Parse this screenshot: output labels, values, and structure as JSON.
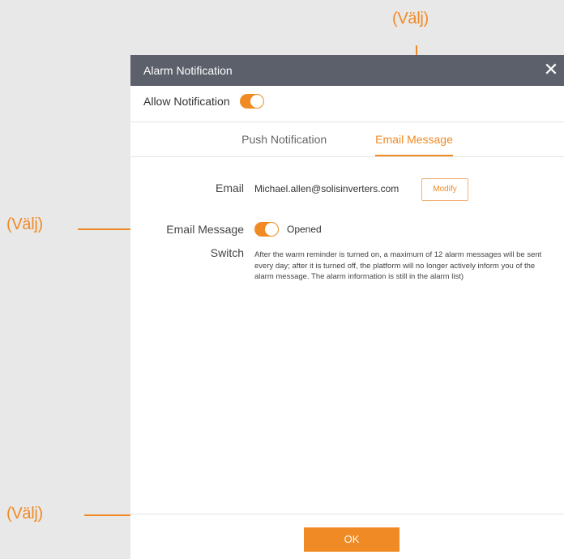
{
  "annotations": {
    "top_label": "(Välj)",
    "left_label": "(Välj)",
    "bottom_label": "(Välj)"
  },
  "dialog": {
    "title": "Alarm Notification",
    "close_icon": "close-icon",
    "allow_notification_label": "Allow Notification",
    "allow_notification_enabled": true,
    "tabs": [
      {
        "label": "Push Notification",
        "active": false
      },
      {
        "label": "Email Message",
        "active": true
      }
    ],
    "email_label": "Email",
    "email_value": "Michael.allen@solisinverters.com",
    "modify_label": "Modify",
    "email_switch_label_line1": "Email Message",
    "email_switch_label_line2": "Switch",
    "email_switch_enabled": true,
    "email_switch_status": "Opened",
    "description": "After the warm reminder is turned on, a maximum of 12 alarm messages will be sent every day; after it is turned off, the platform will no longer actively inform you of the alarm message. The alarm information is still in the alarm list)",
    "ok_label": "OK"
  },
  "colors": {
    "accent": "#f08a24",
    "header_bg": "#5c606b",
    "page_bg": "#e8e8e8"
  }
}
